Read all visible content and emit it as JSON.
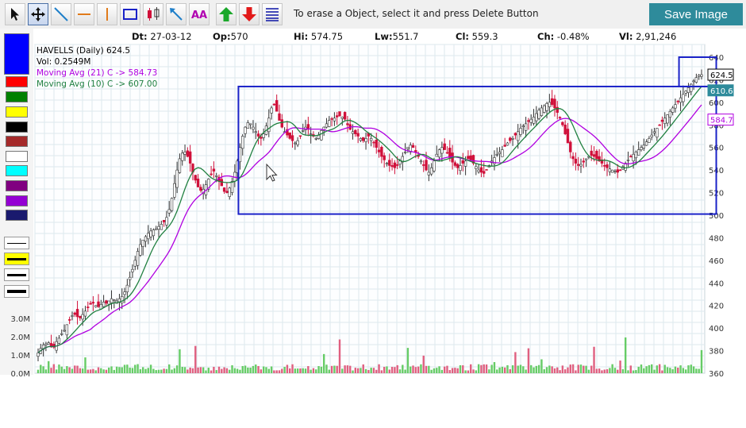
{
  "toolbar": {
    "message": "To erase a Object, select it and press Delete Button",
    "save_label": "Save Image",
    "tools": [
      "pointer-icon",
      "move-icon",
      "trend-line-icon",
      "horizontal-line-icon",
      "vertical-line-icon",
      "rectangle-icon",
      "candle-icon",
      "arrow-icon",
      "text-icon",
      "buy-arrow-icon",
      "sell-arrow-icon",
      "fibonacci-icon"
    ]
  },
  "palette": {
    "colors": [
      "#0000ff",
      "#ff0000",
      "#008000",
      "#ffff00",
      "#000000",
      "#a52a2a",
      "#ffffff",
      "#00ffff",
      "#800080",
      "#9400d3",
      "#1a1a6e"
    ],
    "line_widths": [
      1,
      3,
      3,
      4
    ]
  },
  "info": {
    "dt_label": "Dt:",
    "dt": "27-03-12",
    "op_label": "Op:",
    "op": "570",
    "hi_label": "Hi:",
    "hi": "574.75",
    "lw_label": "Lw:",
    "lw": "551.7",
    "cl_label": "Cl:",
    "cl": "559.3",
    "ch_label": "Ch:",
    "ch": "-0.48%",
    "vl_label": "Vl:",
    "vl": "2,91,246"
  },
  "legend": {
    "symbol": "HAVELLS (Daily) 624.5",
    "vol": "Vol: 0.2549M",
    "ma21": "Moving Avg (21) C -> 584.73",
    "ma10": "Moving Avg (10) C -> 607.00",
    "ma21_color": "#b000e0",
    "ma10_color": "#208040"
  },
  "colors": {
    "up": "#ffffff",
    "down": "#d0103a",
    "vol_up": "#66cc66",
    "vol_down": "#e06080",
    "grid": "#dde8ee",
    "drawing": "#1a22c8"
  },
  "chart_data": {
    "type": "candlestick",
    "y_ticks": [
      640,
      620,
      600,
      580,
      560,
      540,
      520,
      500,
      480,
      460,
      440,
      420,
      400,
      380,
      360
    ],
    "ylim": [
      360,
      640
    ],
    "vol_ticks": [
      "3.0M",
      "2.0M",
      "1.0M",
      "0.0M"
    ],
    "vol_lim": [
      0,
      3.0
    ],
    "price_tags": [
      {
        "value": "624.5",
        "color": "#000000"
      },
      {
        "value": "610.6",
        "color": "#2e8b9b"
      },
      {
        "value": "584.7",
        "color": "#b000e0"
      }
    ],
    "close_path": [
      378,
      382,
      385,
      386,
      387,
      384,
      383,
      388,
      391,
      395,
      398,
      403,
      407,
      411,
      412,
      410,
      409,
      412,
      415,
      418,
      421,
      422,
      420,
      419,
      421,
      423,
      422,
      424,
      426,
      425,
      424,
      426,
      428,
      432,
      438,
      445,
      452,
      460,
      468,
      474,
      478,
      481,
      484,
      486,
      487,
      488,
      490,
      492,
      494,
      498,
      505,
      515,
      528,
      540,
      550,
      555,
      556,
      552,
      546,
      538,
      531,
      525,
      522,
      523,
      527,
      532,
      536,
      539,
      535,
      530,
      526,
      521,
      520,
      524,
      530,
      538,
      548,
      560,
      570,
      578,
      582,
      581,
      578,
      574,
      570,
      568,
      572,
      579,
      586,
      595,
      598,
      592,
      584,
      578,
      574,
      571,
      568,
      566,
      564,
      566,
      570,
      575,
      578,
      576,
      572,
      570,
      568,
      571,
      575,
      578,
      581,
      584,
      585,
      586,
      587,
      588,
      587,
      585,
      580,
      576,
      574,
      572,
      570,
      568,
      566,
      568,
      570,
      568,
      564,
      560,
      556,
      552,
      549,
      546,
      544,
      543,
      542,
      544,
      548,
      552,
      556,
      560,
      562,
      560,
      556,
      552,
      548,
      544,
      540,
      538,
      542,
      548,
      554,
      558,
      560,
      558,
      555,
      551,
      547,
      544,
      542,
      544,
      546,
      548,
      550,
      549,
      546,
      543,
      540,
      538,
      537,
      540,
      544,
      548,
      551,
      554,
      556,
      558,
      561,
      564,
      566,
      568,
      571,
      574,
      577,
      579,
      581,
      583,
      585,
      587,
      590,
      593,
      595,
      597,
      599,
      600,
      598,
      595,
      591,
      586,
      580,
      572,
      564,
      556,
      550,
      546,
      544,
      545,
      547,
      550,
      552,
      553,
      552,
      550,
      548,
      546,
      544,
      542,
      541,
      540,
      539,
      538,
      540,
      543,
      546,
      549,
      552,
      554,
      556,
      558,
      560,
      562,
      565,
      568,
      571,
      574,
      577,
      580,
      583,
      586,
      589,
      592,
      595,
      598,
      601,
      604,
      607,
      610,
      613,
      616,
      619,
      622,
      624,
      624.5
    ],
    "rect_range": {
      "from_index": 77,
      "to_index": 258,
      "top": 614,
      "bottom": 501
    },
    "rect_recent": {
      "from_index": 245,
      "to_index": 258,
      "top": 640,
      "bottom": 614
    }
  }
}
